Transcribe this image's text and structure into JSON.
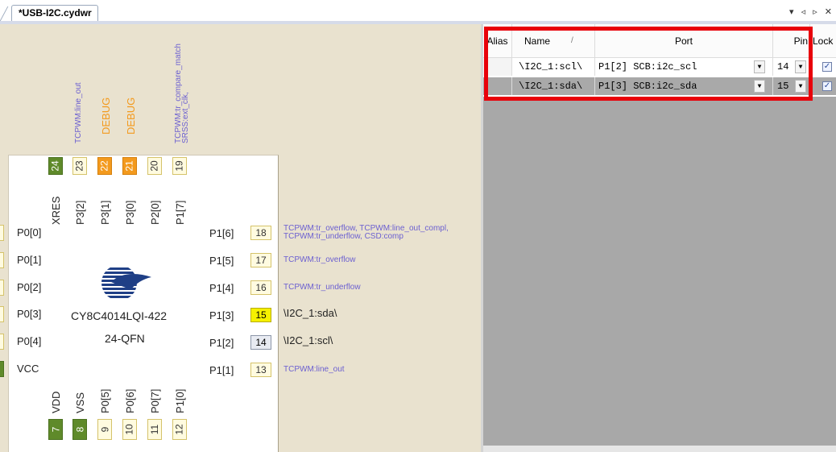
{
  "tab": {
    "title": "*USB-I2C.cydwr",
    "controls": "▾ ◃ ▹ ✕"
  },
  "chip": {
    "part": "CY8C4014LQI-422",
    "package": "24-QFN",
    "top_pins": [
      {
        "num": "24",
        "port": "XRES",
        "label": "",
        "style": "green"
      },
      {
        "num": "23",
        "port": "P3[2]",
        "label": "TCPWM:line_out",
        "style": "yellow"
      },
      {
        "num": "22",
        "port": "P3[1]",
        "label": "DEBUG",
        "style": "orange"
      },
      {
        "num": "21",
        "port": "P3[0]",
        "label": "DEBUG",
        "style": "orange"
      },
      {
        "num": "20",
        "port": "P2[0]",
        "label": "",
        "style": "yellow"
      },
      {
        "num": "19",
        "port": "P1[7]",
        "label": "TCPWM:tr_compare_match\nSRSS:ext_clk,",
        "style": "yellow"
      }
    ],
    "left_pins": [
      {
        "port": "P0[0]",
        "style": "yellow"
      },
      {
        "port": "P0[1]",
        "style": "yellow"
      },
      {
        "port": "P0[2]",
        "style": "yellow"
      },
      {
        "port": "P0[3]",
        "style": "yellow"
      },
      {
        "port": "P0[4]",
        "style": "yellow"
      },
      {
        "port": "VCC",
        "style": "green"
      }
    ],
    "right_pins": [
      {
        "port": "P1[6]",
        "num": "18",
        "label": "TCPWM:tr_overflow, TCPWM:line_out_compl,\nTCPWM:tr_underflow, CSD:comp",
        "style": "yellow",
        "dark": false
      },
      {
        "port": "P1[5]",
        "num": "17",
        "label": "TCPWM:tr_overflow",
        "style": "yellow",
        "dark": false
      },
      {
        "port": "P1[4]",
        "num": "16",
        "label": "TCPWM:tr_underflow",
        "style": "yellow",
        "dark": false
      },
      {
        "port": "P1[3]",
        "num": "15",
        "label": "\\I2C_1:sda\\",
        "style": "bright",
        "dark": true
      },
      {
        "port": "P1[2]",
        "num": "14",
        "label": "\\I2C_1:scl\\",
        "style": "grey",
        "dark": true
      },
      {
        "port": "P1[1]",
        "num": "13",
        "label": "TCPWM:line_out",
        "style": "yellow",
        "dark": false
      }
    ],
    "bottom_pins": [
      {
        "num": "7",
        "port": "VDD",
        "style": "green"
      },
      {
        "num": "8",
        "port": "VSS",
        "style": "green"
      },
      {
        "num": "9",
        "port": "P0[5]",
        "style": "yellow"
      },
      {
        "num": "10",
        "port": "P0[6]",
        "style": "yellow"
      },
      {
        "num": "11",
        "port": "P0[7]",
        "style": "yellow"
      },
      {
        "num": "12",
        "port": "P1[0]",
        "style": "yellow"
      }
    ]
  },
  "grid": {
    "headers": {
      "alias": "Alias",
      "name": "Name",
      "sort": "/",
      "port": "Port",
      "pin": "Pin",
      "lock": "Lock"
    },
    "rows": [
      {
        "name": "\\I2C_1:scl\\",
        "port": "P1[2] SCB:i2c_scl",
        "pin": "14",
        "locked": true,
        "selected": false
      },
      {
        "name": "\\I2C_1:sda\\",
        "port": "P1[3] SCB:i2c_sda",
        "pin": "15",
        "locked": true,
        "selected": true
      }
    ],
    "highlight_color": "#e8000a"
  }
}
